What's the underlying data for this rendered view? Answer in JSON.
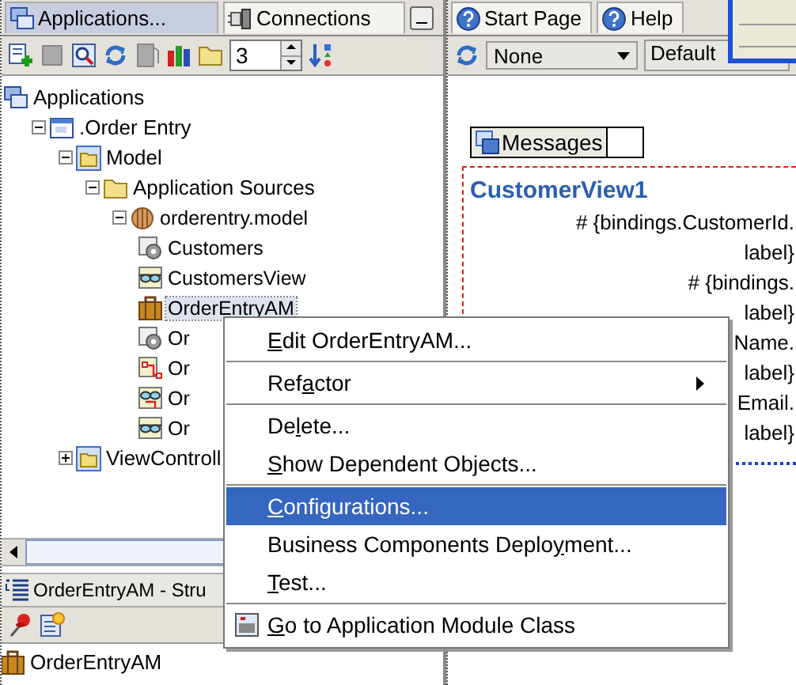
{
  "app_panel": {
    "tabs": [
      {
        "label": "Applications...",
        "selected": true
      },
      {
        "label": "Connections",
        "selected": false
      }
    ],
    "level_spinner": {
      "value": "3"
    },
    "tree": [
      {
        "label": "Applications",
        "kind": "apps",
        "selected": false,
        "children": [
          {
            "label": ".Order Entry",
            "kind": "workspace",
            "expanded": true,
            "selected": false,
            "children": [
              {
                "label": "Model",
                "kind": "project",
                "expanded": true,
                "selected": false,
                "children": [
                  {
                    "label": "Application Sources",
                    "kind": "folder",
                    "expanded": true,
                    "selected": false,
                    "children": [
                      {
                        "label": "orderentry.model",
                        "kind": "package",
                        "expanded": true,
                        "selected": false,
                        "children": [
                          {
                            "label": "Customers",
                            "kind": "entity",
                            "selected": false
                          },
                          {
                            "label": "CustomersView",
                            "kind": "view",
                            "selected": false
                          },
                          {
                            "label": "OrderEntryAM",
                            "kind": "module",
                            "selected": true
                          },
                          {
                            "label": "Or",
                            "kind": "entity",
                            "selected": false
                          },
                          {
                            "label": "Or",
                            "kind": "link",
                            "selected": false
                          },
                          {
                            "label": "Or",
                            "kind": "viewlink",
                            "selected": false
                          },
                          {
                            "label": "Or",
                            "kind": "view",
                            "selected": false
                          }
                        ]
                      }
                    ]
                  }
                ]
              },
              {
                "label": "ViewControll",
                "kind": "project",
                "expanded": false,
                "selected": false
              }
            ]
          }
        ]
      }
    ]
  },
  "structure_panel": {
    "title": "OrderEntryAM - Stru",
    "tree": [
      {
        "label": "OrderEntryAM",
        "kind": "module",
        "selected": false
      }
    ]
  },
  "editor": {
    "tabs": [
      {
        "label": "Start Page",
        "selected": false
      },
      {
        "label": "Help",
        "selected": false
      }
    ],
    "dropdown": {
      "value": "None"
    },
    "style_field": {
      "value": "Default"
    },
    "messages_tab": {
      "label": "Messages"
    },
    "form_title": "CustomerView1",
    "lines": [
      "# {bindings.CustomerId.",
      "label}",
      "# {bindings.",
      "label}",
      "Name.",
      "label}",
      "Email.",
      "label}"
    ]
  },
  "context_menu": {
    "groups": [
      [
        {
          "mnemonic": "E",
          "after": "dit OrderEntryAM...",
          "kind": "plain",
          "selected": false
        }
      ],
      [
        {
          "before": "Ref",
          "mnemonic": "a",
          "after": "ctor",
          "kind": "submenu",
          "selected": false
        }
      ],
      [
        {
          "before": "De",
          "mnemonic": "l",
          "after": "ete...",
          "kind": "plain",
          "selected": false
        },
        {
          "mnemonic": "S",
          "after": "how Dependent Objects...",
          "kind": "plain",
          "selected": false
        }
      ],
      [
        {
          "mnemonic": "C",
          "after": "onfigurations...",
          "kind": "plain",
          "selected": true
        },
        {
          "before": "Business Components Deplo",
          "mnemonic": "y",
          "after": "ment...",
          "kind": "plain",
          "selected": false
        },
        {
          "mnemonic": "T",
          "after": "est...",
          "kind": "plain",
          "selected": false
        }
      ],
      [
        {
          "mnemonic": "G",
          "after": "o to Application Module Class",
          "kind": "icon",
          "selected": false
        }
      ]
    ]
  }
}
